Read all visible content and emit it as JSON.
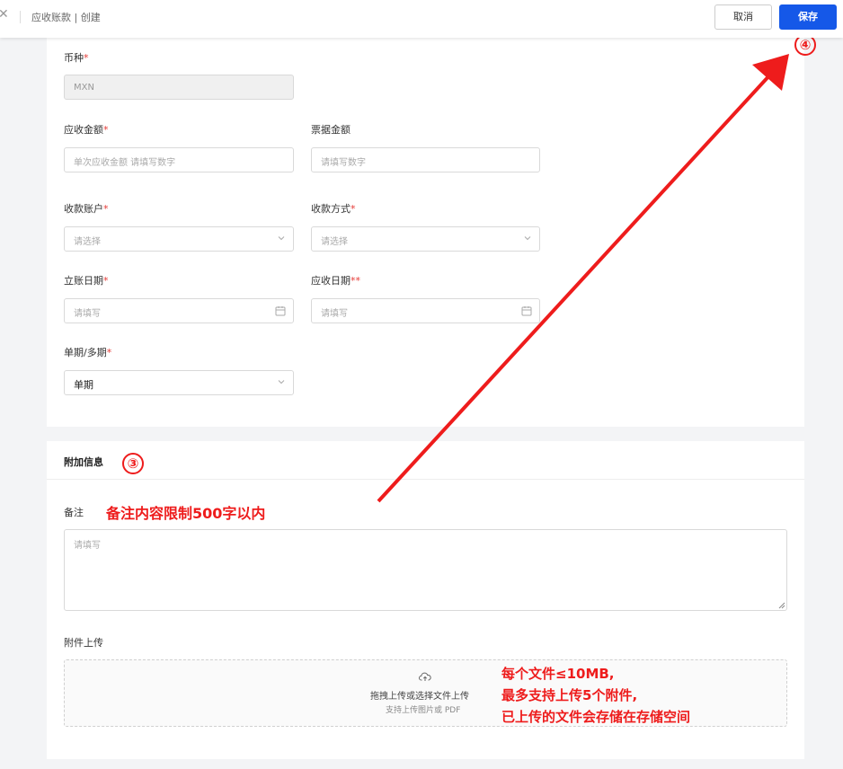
{
  "header": {
    "breadcrumb": "应收账款 | 创建",
    "cancel_label": "取消",
    "save_label": "保存"
  },
  "form": {
    "currency": {
      "label": "币种",
      "required": "*",
      "value": "MXN"
    },
    "receivable_amount": {
      "label": "应收金额",
      "required": "*",
      "placeholder": "单次应收金额 请填写数字"
    },
    "bill_amount": {
      "label": "票据金额",
      "placeholder": "请填写数字"
    },
    "receiving_account": {
      "label": "收款账户",
      "required": "*",
      "placeholder": "请选择"
    },
    "payment_method": {
      "label": "收款方式",
      "required": "*",
      "placeholder": "请选择"
    },
    "booking_date": {
      "label": "立账日期",
      "required": "*",
      "placeholder": "请填写"
    },
    "due_date": {
      "label": "应收日期",
      "required": "**",
      "placeholder": "请填写"
    },
    "period": {
      "label": "单期/多期",
      "required": "*",
      "value": "单期"
    }
  },
  "extra": {
    "section_title": "附加信息",
    "remark_label": "备注",
    "remark_placeholder": "请填写",
    "attachment_label": "附件上传",
    "upload_main": "拖拽上传或选择文件上传",
    "upload_sub": "支持上传图片或 PDF"
  },
  "annotations": {
    "circle_3": "③",
    "circle_4": "④",
    "note_limit": "备注内容限制500字以内",
    "file_lines": [
      "每个文件≤10MB,",
      "最多支持上传5个附件,",
      "已上传的文件会存储在存储空间"
    ]
  },
  "colors": {
    "primary": "#1558e8",
    "annotation": "#ee1c1c",
    "required": "#e53935"
  }
}
